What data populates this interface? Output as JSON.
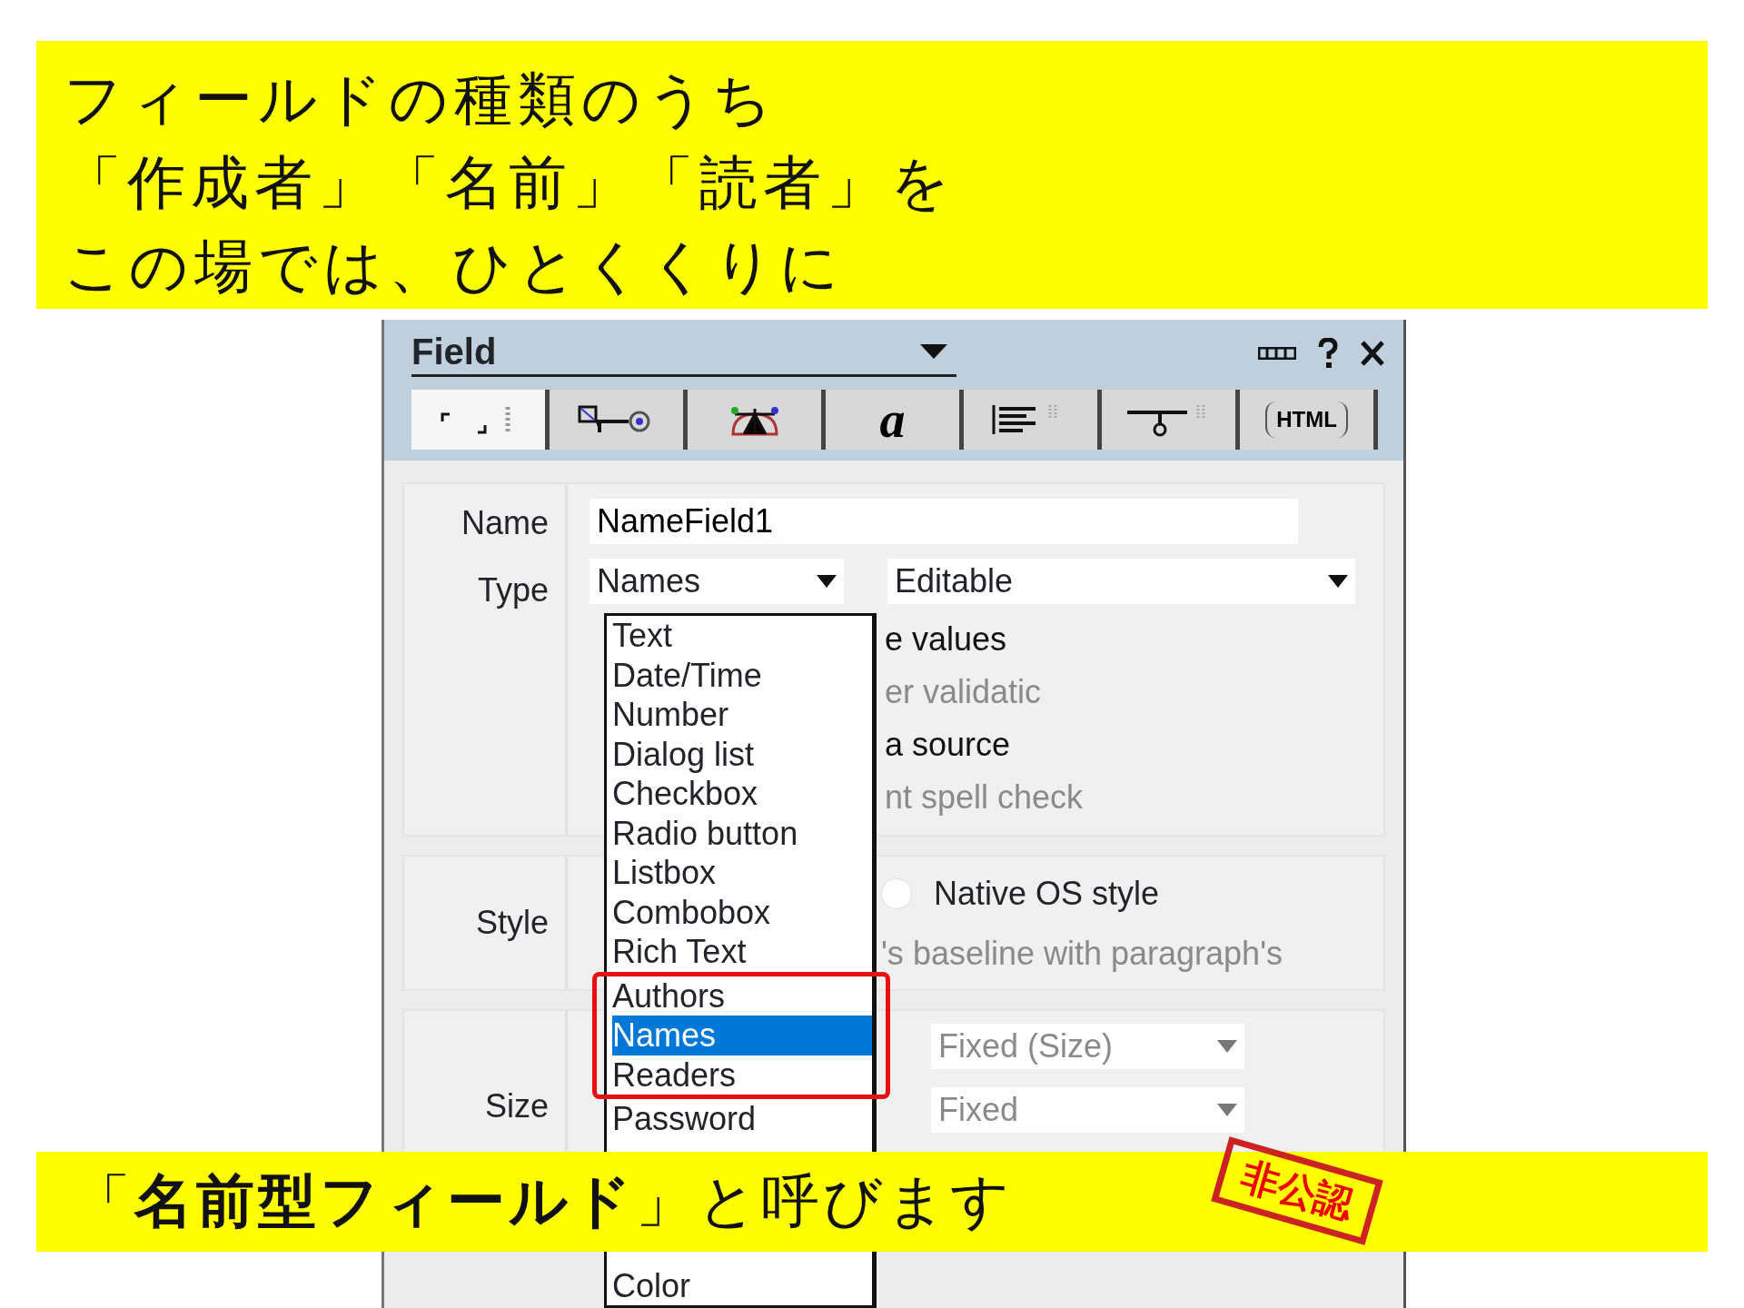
{
  "top_banner": {
    "lines": [
      "フィールドの種類のうち",
      "「作成者」「名前」「読者」を",
      "この場では、ひとくくりに"
    ]
  },
  "dialog": {
    "title": "Field",
    "tabs": [
      {
        "selected": true
      },
      {
        "selected": false
      },
      {
        "selected": false
      },
      {
        "label": "a",
        "selected": false
      },
      {
        "selected": false
      },
      {
        "selected": false
      },
      {
        "label": "HTML",
        "selected": false
      }
    ],
    "name_label": "Name",
    "name_value": "NameField1",
    "type_label": "Type",
    "type_value": "Names",
    "mode_value": "Editable",
    "option_fragments": [
      {
        "text": "e values",
        "disabled": false
      },
      {
        "text": "er validatic",
        "disabled": true
      },
      {
        "text": "a source",
        "disabled": false
      },
      {
        "text": "nt spell check",
        "disabled": true
      }
    ],
    "style_label": "Style",
    "radio_label": "Native OS style",
    "radio_checked": false,
    "baseline_text": "'s baseline with paragraph's",
    "size_label": "Size",
    "width_value": "Fixed (Size)",
    "height_value": "Fixed",
    "type_list": [
      {
        "text": "Text",
        "selected": false,
        "highlighted": false
      },
      {
        "text": "Date/Time",
        "selected": false,
        "highlighted": false
      },
      {
        "text": "Number",
        "selected": false,
        "highlighted": false
      },
      {
        "text": "Dialog list",
        "selected": false,
        "highlighted": false
      },
      {
        "text": "Checkbox",
        "selected": false,
        "highlighted": false
      },
      {
        "text": "Radio button",
        "selected": false,
        "highlighted": false
      },
      {
        "text": "Listbox",
        "selected": false,
        "highlighted": false
      },
      {
        "text": "Combobox",
        "selected": false,
        "highlighted": false
      },
      {
        "text": "Rich Text",
        "selected": false,
        "highlighted": false
      },
      {
        "text": "Authors",
        "selected": false,
        "highlighted": true
      },
      {
        "text": "Names",
        "selected": true,
        "highlighted": true
      },
      {
        "text": "Readers",
        "selected": false,
        "highlighted": true
      },
      {
        "text": "Password",
        "selected": false,
        "highlighted": false
      },
      {
        "text": "Color",
        "selected": false,
        "highlighted": false
      }
    ]
  },
  "bottom_banner": {
    "text": "「**名前型フィールド**」と呼びます",
    "stamp": "非公認"
  }
}
